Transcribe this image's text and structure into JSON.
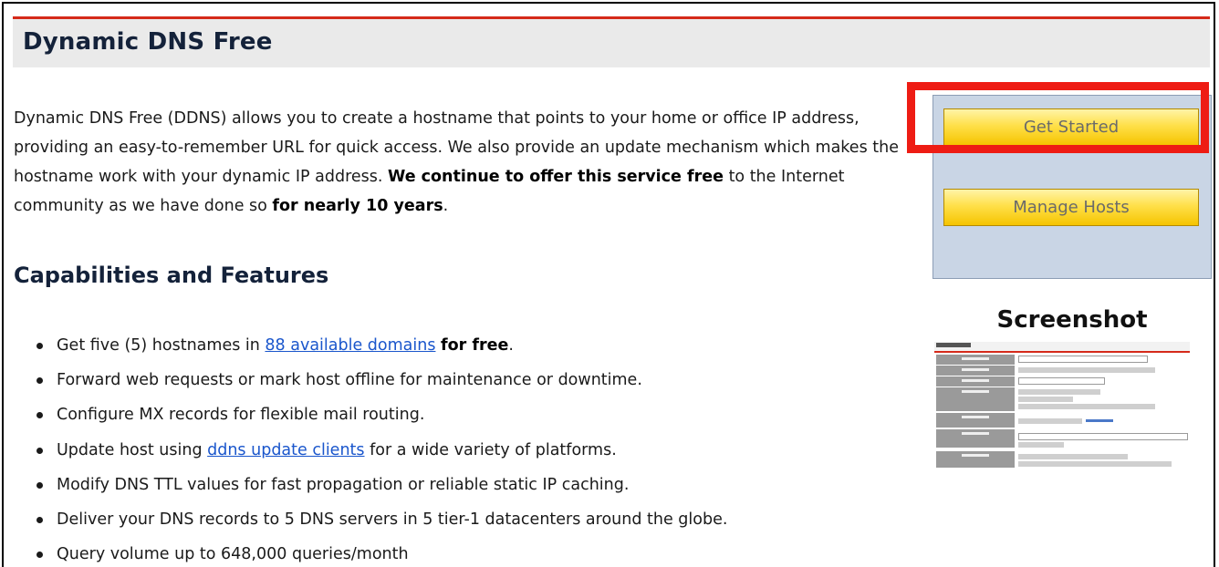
{
  "page": {
    "title": "Dynamic DNS Free"
  },
  "intro": {
    "text_1": "Dynamic DNS Free (DDNS) allows you to create a hostname that points to your home or office IP address, providing an easy-to-remember URL for quick access. We also provide an update mechanism which makes the hostname work with your dynamic IP address. ",
    "bold_1": "We continue to offer this service free",
    "text_2": " to the Internet community as we have done so ",
    "bold_2": "for nearly 10 years",
    "text_3": "."
  },
  "capabilities": {
    "heading": "Capabilities and Features",
    "items": [
      {
        "pre": "Get five (5) hostnames in ",
        "link": "88 available domains",
        "post": " ",
        "bold": "for free",
        "end": "."
      },
      {
        "text": "Forward web requests or mark host offline for maintenance or downtime."
      },
      {
        "text": "Configure MX records for flexible mail routing."
      },
      {
        "pre": "Update host using ",
        "link": "ddns update clients",
        "post": " for a wide variety of platforms."
      },
      {
        "text": "Modify DNS TTL values for fast propagation or reliable static IP caching."
      },
      {
        "text": "Deliver your DNS records to 5 DNS servers in 5 tier-1 datacenters around the globe."
      },
      {
        "text": "Query volume up to 648,000 queries/month"
      }
    ]
  },
  "sidebar": {
    "get_started_label": "Get Started",
    "manage_hosts_label": "Manage Hosts",
    "screenshot_heading": "Screenshot"
  },
  "colors": {
    "title_bar_accent": "#d52a1a",
    "button_yellow": "#ffe04a",
    "sidebar_box": "#c9d5e5",
    "highlight_red": "#ee1c14",
    "link_blue": "#1a56cc"
  },
  "icons": {
    "bullet": "bullet-dot-icon"
  }
}
